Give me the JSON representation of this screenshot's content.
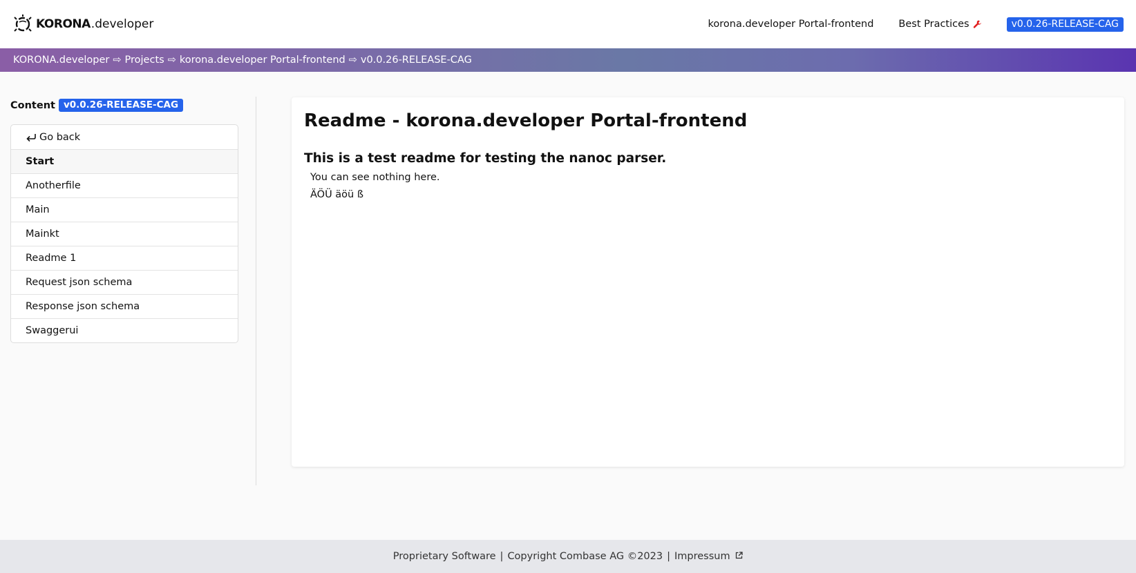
{
  "header": {
    "logo_korona": "KORONA",
    "logo_developer": ".developer",
    "nav": {
      "project_link": "korona.developer Portal-frontend",
      "best_practices_link": "Best Practices",
      "version_badge": "v0.0.26-RELEASE-CAG"
    }
  },
  "breadcrumb": {
    "items": [
      "KORONA.developer",
      "Projects",
      "korona.developer Portal-frontend",
      "v0.0.26-RELEASE-CAG"
    ],
    "separator": "⇨"
  },
  "sidebar": {
    "title": "Content",
    "version_badge": "v0.0.26-RELEASE-CAG",
    "back_label": "Go back",
    "items": [
      {
        "label": "Start"
      },
      {
        "label": "Anotherfile"
      },
      {
        "label": "Main"
      },
      {
        "label": "Mainkt"
      },
      {
        "label": "Readme 1"
      },
      {
        "label": "Request json schema"
      },
      {
        "label": "Response json schema"
      },
      {
        "label": "Swaggerui"
      }
    ]
  },
  "main": {
    "title": "Readme - korona.developer Portal-frontend",
    "subtitle": "This is a test readme for testing the nanoc parser.",
    "paragraphs": [
      "You can see nothing here.",
      "ÄÖÜ äöü ß"
    ]
  },
  "footer": {
    "license": "Proprietary Software",
    "copyright": "Copyright Combase AG ©2023",
    "impressum": "Impressum"
  },
  "colors": {
    "accent": "#2563eb",
    "band_start": "#8a5ea6",
    "band_end": "#5a34b0",
    "wrench": "#e11d1d"
  },
  "icons": {
    "logo": "korona-logo-icon",
    "best_practices": "wrench-icon",
    "back": "return-arrow-icon",
    "external": "external-link-icon"
  }
}
